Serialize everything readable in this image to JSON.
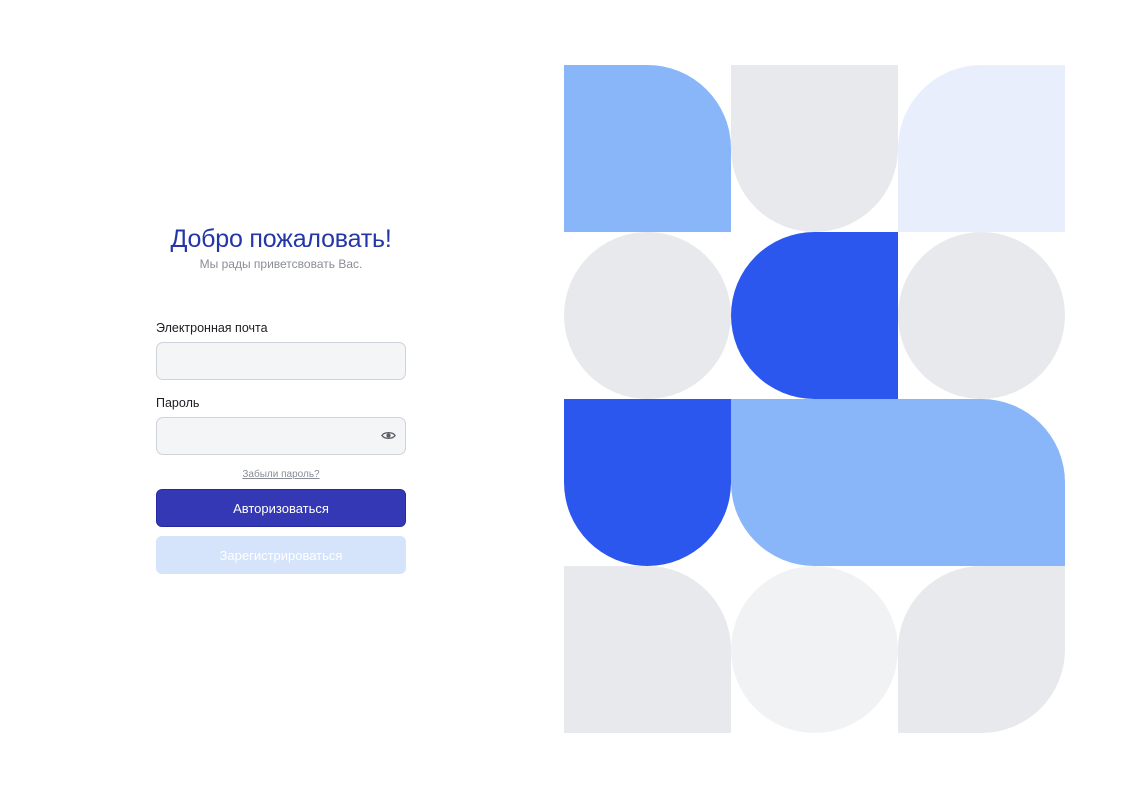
{
  "login": {
    "title": "Добро пожаловать!",
    "subtitle": "Мы рады приветсвовать Вас.",
    "email": {
      "label": "Электронная почта",
      "value": "",
      "placeholder": ""
    },
    "password": {
      "label": "Пароль",
      "value": "",
      "placeholder": "",
      "toggle_icon": "eye-icon"
    },
    "forgot_link": "Забыли пароль?",
    "submit_button": "Авторизоваться",
    "register_button": "Зарегистрироваться"
  },
  "colors": {
    "title": "#2436a8",
    "primary_button": "#3438b4",
    "secondary_button": "#d5e4fb",
    "field_background": "#f4f5f7",
    "art_blue": "#2b57ee",
    "art_light_blue": "#88b6f8",
    "art_lavender": "#e9eefd",
    "art_gray": "#e8e9ec",
    "art_pale_gray": "#f1f2f4"
  },
  "art": {
    "rows": [
      [
        {
          "shape": "leaf-top-right",
          "color": "art_light_blue"
        },
        {
          "shape": "arch-bottom",
          "color": "art_gray"
        },
        {
          "shape": "leaf-top-left",
          "color": "art_lavender"
        }
      ],
      [
        {
          "shape": "circle",
          "color": "art_gray"
        },
        {
          "shape": "leaf-left",
          "color": "art_blue"
        },
        {
          "shape": "circle",
          "color": "art_gray"
        }
      ],
      [
        {
          "shape": "arch-bottom",
          "color": "art_blue"
        },
        {
          "shape": "leaf-bottom-left",
          "color": "art_light_blue"
        },
        {
          "shape": "leaf-top-right",
          "color": "art_light_blue"
        }
      ],
      [
        {
          "shape": "leaf-top-right",
          "color": "art_gray"
        },
        {
          "shape": "circle",
          "color": "art_pale_gray"
        },
        {
          "shape": "leaf-top-left-bottom-right",
          "color": "art_gray"
        }
      ]
    ]
  }
}
